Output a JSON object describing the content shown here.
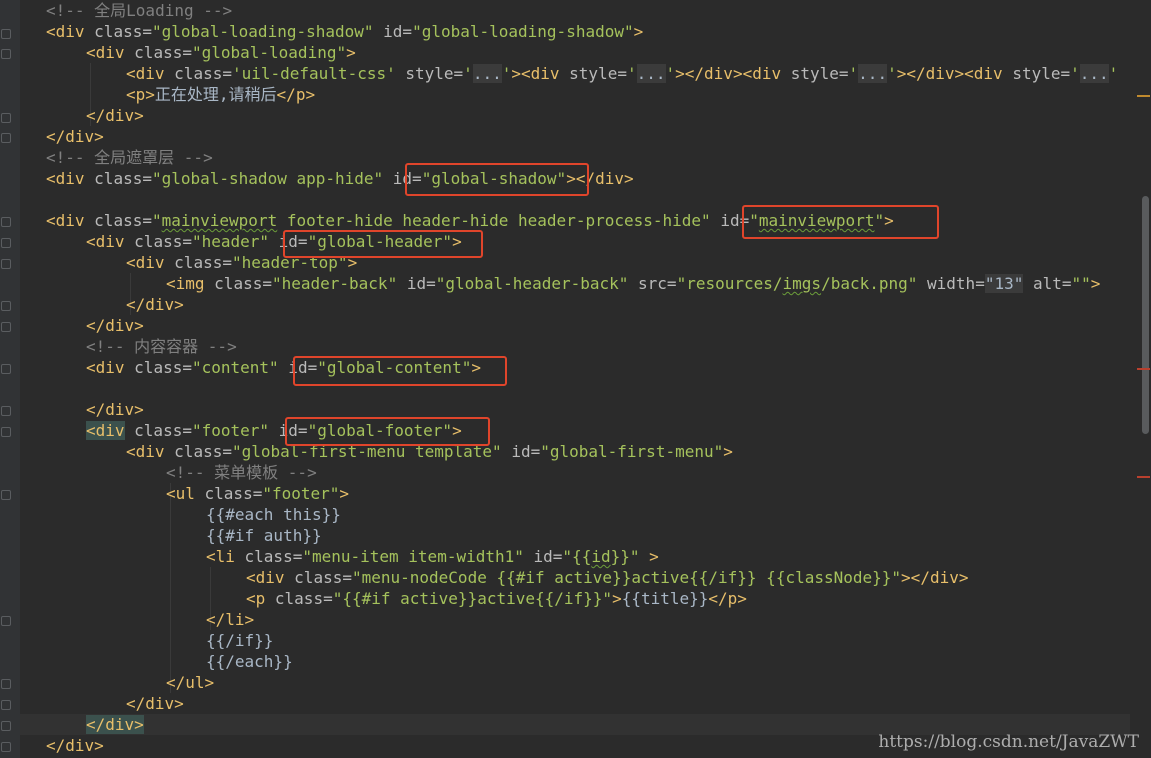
{
  "editor": {
    "language": "html",
    "lines": {
      "l0_c": "<!-- 全局Loading -->",
      "l1_a": "<div ",
      "l1_b": "class=",
      "l1_c": "\"global-loading-shadow\"",
      "l1_d": " id=",
      "l1_e": "\"global-loading-shadow\"",
      "l1_f": ">",
      "l2_a": "<div ",
      "l2_b": "class=",
      "l2_c": "\"global-loading\"",
      "l2_d": ">",
      "l3_a": "<div ",
      "l3_b": "class=",
      "l3_c": "'uil-default-css'",
      "l3_d": " style=",
      "l3_e": "'",
      "l3_f": "...",
      "l3_g": "'",
      "l3_h": "><div ",
      "l3_i": "style=",
      "l3_j": "'",
      "l3_k": "...",
      "l3_l": "'",
      "l3_m": "></div><div ",
      "l3_n": "style=",
      "l3_o": "'",
      "l3_p": "...",
      "l3_q": "'",
      "l3_r": "></div><div ",
      "l3_s": "style=",
      "l3_t": "'",
      "l3_u": "...",
      "l3_v": "'",
      "l4_a": "<p>",
      "l4_b": "正在处理,请稍后",
      "l4_c": "</p>",
      "l5": "</div>",
      "l6": "</div>",
      "l7_c": "<!-- 全局遮罩层 -->",
      "l8_a": "<div ",
      "l8_b": "class=",
      "l8_c": "\"global-shadow app-hide\"",
      "l8_d": " id=",
      "l8_e": "\"global-shadow\"",
      "l8_f": "></div>",
      "l10_a": "<div ",
      "l10_b": "class=",
      "l10_c1": "\"",
      "l10_c2": "mainviewport",
      "l10_c3": " footer-hide header-hide header-process-hide\"",
      "l10_d": " id=",
      "l10_e1": "\"",
      "l10_e2": "mainviewport",
      "l10_e3": "\"",
      "l10_f": ">",
      "l11_a": "<div ",
      "l11_b": "class=",
      "l11_c": "\"header\"",
      "l11_d": " id=",
      "l11_e": "\"global-header\"",
      "l11_f": ">",
      "l12_a": "<div ",
      "l12_b": "class=",
      "l12_c": "\"header-top\"",
      "l12_d": ">",
      "l13_a": "<img ",
      "l13_b": "class=",
      "l13_c": "\"header-back\"",
      "l13_d": " id=",
      "l13_e": "\"global-header-back\"",
      "l13_f": " src=",
      "l13_g1": "\"resources/",
      "l13_g2": "imgs",
      "l13_g3": "/back.png\"",
      "l13_h": " width=",
      "l13_i": "\"13\"",
      "l13_j": " alt=",
      "l13_k": "\"\"",
      "l13_l": ">",
      "l14": "</div>",
      "l15": "</div>",
      "l16_c": "<!-- 内容容器 -->",
      "l17_a": "<div ",
      "l17_b": "class=",
      "l17_c": "\"content\"",
      "l17_d": " id=",
      "l17_e": "\"global-content\"",
      "l17_f": ">",
      "l19": "</div>",
      "l20_a": "<div",
      "l20_b": " class=",
      "l20_c": "\"footer\"",
      "l20_d": " id=",
      "l20_e": "\"global-footer\"",
      "l20_f": ">",
      "l21_a": "<div ",
      "l21_b": "class=",
      "l21_c": "\"global-first-menu template\"",
      "l21_d": " id=",
      "l21_e": "\"global-first-menu\"",
      "l21_f": ">",
      "l22_c": "<!-- 菜单模板 -->",
      "l23_a": "<ul ",
      "l23_b": "class=",
      "l23_c": "\"footer\"",
      "l23_d": ">",
      "l24": "{{#each this}}",
      "l25": "{{#if auth}}",
      "l26_a": "<li ",
      "l26_b": "class=",
      "l26_c": "\"menu-item item-width1\"",
      "l26_d": " id=",
      "l26_e1": "\"{{",
      "l26_e2": "id",
      "l26_e3": "}}\"",
      "l26_f": " >",
      "l27_a": "<div ",
      "l27_b": "class=",
      "l27_c": "\"menu-nodeCode {{#if active}}active{{/if}} {{classNode}}\"",
      "l27_d": "></div>",
      "l28_a": "<p ",
      "l28_b": "class=",
      "l28_c": "\"{{#if active}}active{{/if}}\"",
      "l28_d": ">",
      "l28_e": "{{title}}",
      "l28_f": "</p>",
      "l29": "</li>",
      "l30": "{{/if}}",
      "l31": "{{/each}}",
      "l32": "</ul>",
      "l33": "</div>",
      "l34": "</div>",
      "l35": "</div>"
    }
  },
  "watermark": "https://blog.csdn.net/JavaZWT",
  "colors": {
    "background": "#2b2b2b",
    "tag": "#e8bf6a",
    "attribute": "#bababa",
    "string": "#a5c25c",
    "comment": "#808080",
    "highlight_box": "#e0452b"
  }
}
